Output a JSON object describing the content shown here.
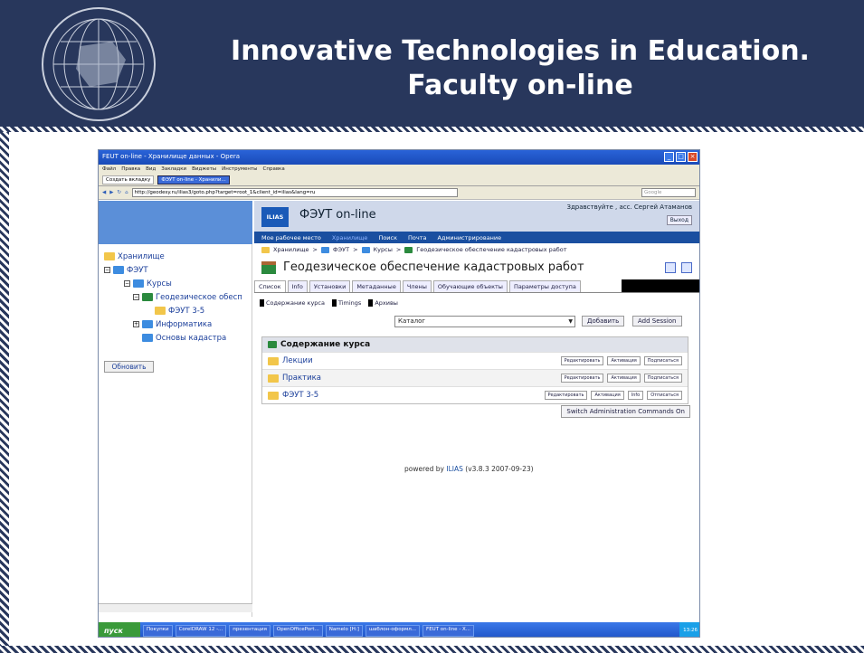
{
  "slide": {
    "title_line1": "Innovative Technologies in Education.",
    "title_line2": "Faculty on-line",
    "logo_text": "Факультет экономики и Управления Территориями"
  },
  "browser": {
    "window_title": "FEUT on-line - Хранилище данных - Opera",
    "menu": [
      "Файл",
      "Правка",
      "Вид",
      "Закладки",
      "Виджеты",
      "Инструменты",
      "Справка"
    ],
    "new_tab": "Создать вкладку",
    "current_tab": "ФЭУТ on-line - Хранили...",
    "url": "http://geodesy.ru/ilias3/goto.php?target=root_1&client_id=ilias&lang=ru",
    "search_placeholder": "Google"
  },
  "tree": {
    "items": [
      {
        "label": "Хранилище"
      },
      {
        "label": "ФЭУТ"
      },
      {
        "label": "Курсы"
      },
      {
        "label": "Геодезическое обесп"
      },
      {
        "label": "ФЭУТ 3-5"
      },
      {
        "label": "Информатика"
      },
      {
        "label": "Основы кадастра"
      }
    ],
    "refresh": "Обновить"
  },
  "app": {
    "logo": "ILIAS",
    "title": "ФЭУТ on-line",
    "greeting": "Здравствуйте , асс. Сергей Атаманов",
    "logout": "Выход",
    "nav": [
      "Мое рабочее место",
      "Хранилище",
      "Поиск",
      "Почта",
      "Администрирование"
    ],
    "breadcrumb": [
      "Хранилище",
      ">",
      "ФЭУТ",
      ">",
      "Курсы",
      ">",
      "Геодезическое обеспечение кадастровых работ"
    ],
    "object_title": "Геодезическое обеспечение кадастровых работ",
    "tabs": [
      "Список",
      "Info",
      "Установки",
      "Метаданные",
      "Члены",
      "Обучающие объекты",
      "Параметры доступа"
    ],
    "subtabs": [
      "Содержание курса",
      "Timings",
      "Архивы"
    ],
    "select_value": "Каталог",
    "add_button": "Добавить",
    "add_session": "Add Session",
    "content_header": "Содержание курса",
    "rows": [
      {
        "label": "Лекции",
        "actions": [
          "Редактировать",
          "Активация",
          "Подписаться"
        ]
      },
      {
        "label": "Практика",
        "actions": [
          "Редактировать",
          "Активация",
          "Подписаться"
        ]
      },
      {
        "label": "ФЭУТ 3-5",
        "actions": [
          "Редактировать",
          "Активация",
          "Info",
          "Отписаться"
        ]
      }
    ],
    "admin_button": "Switch Administration Commands On",
    "powered_prefix": "powered by",
    "powered_brand": "ILIAS",
    "powered_version": "(v3.8.3 2007-09-23)"
  },
  "taskbar": {
    "start": "пуск",
    "tasks": [
      "Покупки",
      "CorelDRAW 12 -...",
      "презентация",
      "OpenOfficePort...",
      "Namelo [H:]",
      "шаблон-оформл...",
      "FEUT on-line - X..."
    ],
    "clock": "13:26"
  }
}
